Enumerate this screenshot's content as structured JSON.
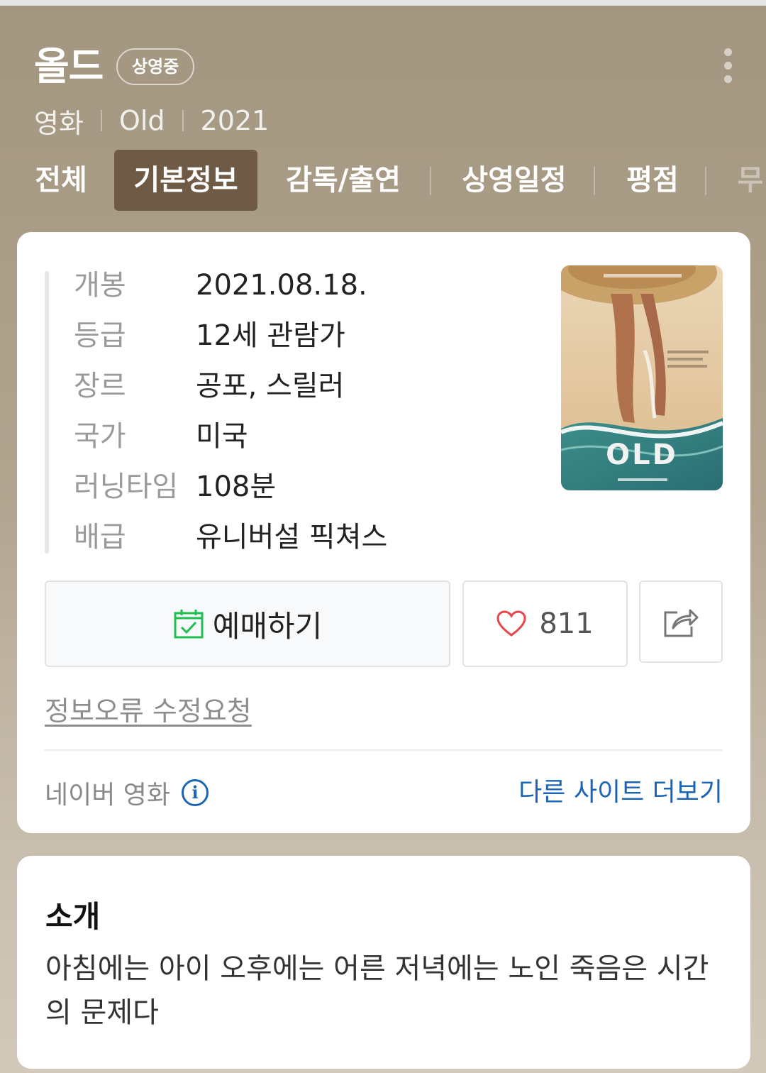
{
  "movie": {
    "title": "올드",
    "status_badge": "상영중",
    "meta": [
      "영화",
      "Old",
      "2021"
    ]
  },
  "tabs": [
    {
      "label": "전체",
      "active": false
    },
    {
      "label": "기본정보",
      "active": true
    },
    {
      "label": "감독/출연",
      "active": false
    },
    {
      "label": "상영일정",
      "active": false
    },
    {
      "label": "평점",
      "active": false
    },
    {
      "label": "무",
      "active": false
    }
  ],
  "info": {
    "rows": [
      {
        "label": "개봉",
        "value": "2021.08.18."
      },
      {
        "label": "등급",
        "value": "12세 관람가"
      },
      {
        "label": "장르",
        "value": "공포, 스릴러"
      },
      {
        "label": "국가",
        "value": "미국"
      },
      {
        "label": "러닝타임",
        "value": "108분"
      },
      {
        "label": "배급",
        "value": "유니버설 픽쳐스"
      }
    ],
    "poster_icon": "movie-poster-old"
  },
  "actions": {
    "book_label": "예매하기",
    "book_icon": "calendar-check-icon",
    "like_count": "811",
    "like_icon": "heart-outline-icon",
    "share_icon": "share-icon"
  },
  "report_link": "정보오류 수정요청",
  "source": {
    "label": "네이버 영화",
    "more_sites": "다른 사이트 더보기"
  },
  "intro": {
    "title": "소개",
    "text": "아침에는 아이 오후에는 어른 저녁에는 노인 죽음은 시간의 문제다"
  },
  "colors": {
    "accent_blue": "#1c64b4",
    "active_tab": "#6f5b45",
    "heart_red": "#e8444b",
    "check_green": "#1fbf4f"
  }
}
